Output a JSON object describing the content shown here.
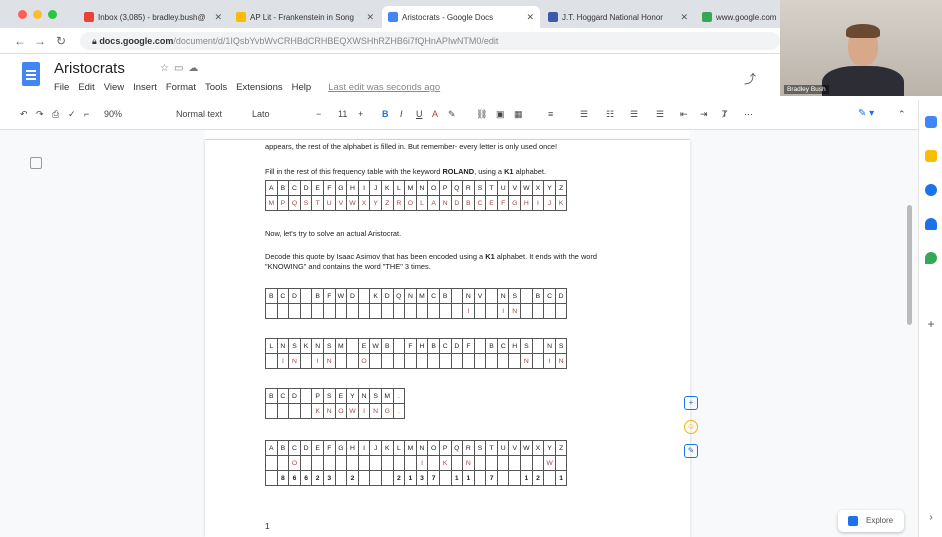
{
  "browser": {
    "tabs": [
      {
        "label": "Inbox (3,085) - bradley.bush@",
        "color": "#ea4335"
      },
      {
        "label": "AP Lit - Frankenstein in Song",
        "color": "#fbbc04"
      },
      {
        "label": "Aristocrats - Google Docs",
        "color": "#4285f4"
      },
      {
        "label": "J.T. Hoggard National Honor",
        "color": "#3c5aa8"
      },
      {
        "label": "www.google.com",
        "color": "#34a853"
      }
    ],
    "url_host": "docs.google.com",
    "url_path": "/document/d/1IQsbYvbWvCRHBdCRHBEQXWSHhRZHB6i7fQHnAPIwNTM0/edit"
  },
  "doc": {
    "title": "Aristocrats",
    "menu": [
      "File",
      "Edit",
      "View",
      "Insert",
      "Format",
      "Tools",
      "Extensions",
      "Help"
    ],
    "last_edit": "Last edit was seconds ago"
  },
  "toolbar": {
    "zoom": "90%",
    "style": "Normal text",
    "font": "Lato",
    "size": "11"
  },
  "webcam": {
    "name": "Bradley Bush"
  },
  "page": {
    "line_partial": "appears, the rest of the alphabet is filled in. But remember- every letter is only used once!",
    "instr1_pre": "Fill in the rest of this frequency table with the keyword ",
    "instr1_kw": "ROLAND",
    "instr1_mid": ", using a ",
    "instr1_k": "K1",
    "instr1_post": " alphabet.",
    "alphabet": [
      "A",
      "B",
      "C",
      "D",
      "E",
      "F",
      "G",
      "H",
      "I",
      "J",
      "K",
      "L",
      "M",
      "N",
      "O",
      "P",
      "Q",
      "R",
      "S",
      "T",
      "U",
      "V",
      "W",
      "X",
      "Y",
      "Z"
    ],
    "k1_row": [
      "M",
      "P",
      "Q",
      "S",
      "T",
      "U",
      "V",
      "W",
      "X",
      "Y",
      "Z",
      "R",
      "O",
      "L",
      "A",
      "N",
      "D",
      "B",
      "C",
      "E",
      "F",
      "G",
      "H",
      "I",
      "J",
      "K"
    ],
    "line2": "Now, let's try to solve an actual Aristocrat.",
    "instr2_pre": "Decode this quote by Isaac Asimov that has been encoded using a ",
    "instr2_k": "K1",
    "instr2_post": " alphabet. It ends with the word \"KNOWING\" and contains the word \"THE\" 3 times.",
    "cipher1": [
      "B",
      "C",
      "D",
      "",
      "B",
      "F",
      "W",
      "D",
      "",
      "K",
      "D",
      "Q",
      "N",
      "M",
      "C",
      "B",
      "",
      "N",
      "V",
      "",
      "N",
      "S",
      "",
      "B",
      "C",
      "D"
    ],
    "plain1": [
      "",
      "",
      "",
      "",
      "",
      "",
      "",
      "",
      "",
      "",
      "",
      "",
      "",
      "",
      "",
      "",
      "",
      "I",
      "",
      "",
      "I",
      "N",
      "",
      "",
      "",
      ""
    ],
    "cipher2": [
      "L",
      "N",
      "S",
      "K",
      "N",
      "S",
      "M",
      "",
      "E",
      "W",
      "B",
      "",
      "F",
      "H",
      "B",
      "C",
      "D",
      "F",
      "",
      "B",
      "C",
      "H",
      "S",
      "",
      "N",
      "S"
    ],
    "plain2": [
      "",
      "I",
      "N",
      "",
      "I",
      "N",
      "",
      "",
      "O",
      "",
      "",
      "",
      "",
      "",
      "",
      "",
      "",
      "",
      "",
      "",
      "",
      "",
      "N",
      "",
      "I",
      "N"
    ],
    "cipher3": [
      "B",
      "C",
      "D",
      "",
      "P",
      "S",
      "E",
      "Y",
      "N",
      "S",
      "M",
      "."
    ],
    "plain3": [
      "",
      "",
      "",
      "",
      "K",
      "N",
      "O",
      "W",
      "I",
      "N",
      "G",
      "."
    ],
    "freq_plain": [
      "",
      "",
      "O",
      "",
      "",
      "",
      "",
      "",
      "",
      "",
      "",
      "",
      "",
      "I",
      "",
      "K",
      "",
      "N",
      "",
      "",
      "",
      "",
      "",
      "",
      "W",
      ""
    ],
    "freq_count": [
      "",
      "8",
      "6",
      "6",
      "2",
      "3",
      "",
      "2",
      "",
      "",
      "",
      "2",
      "1",
      "3",
      "7",
      "",
      "1",
      "1",
      "",
      "7",
      "",
      "",
      "1",
      "2",
      "",
      "1"
    ],
    "page_number": "1"
  },
  "explore_label": "Explore"
}
